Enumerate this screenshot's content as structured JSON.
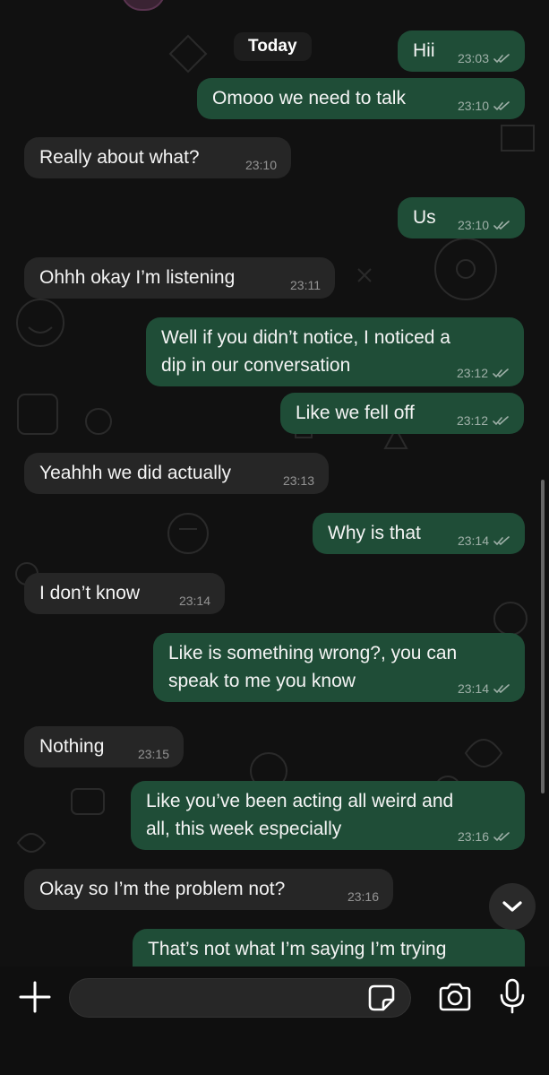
{
  "chat": {
    "date_chip": "Today",
    "messages": [
      {
        "dir": "out",
        "text": "Hii",
        "time": "23:03"
      },
      {
        "dir": "out",
        "text": "Omooo we need to talk",
        "time": "23:10"
      },
      {
        "dir": "in",
        "text": "Really about what?",
        "time": "23:10"
      },
      {
        "dir": "out",
        "text": "Us",
        "time": "23:10"
      },
      {
        "dir": "in",
        "text": "Ohhh okay I’m listening",
        "time": "23:11"
      },
      {
        "dir": "out",
        "text": "Well if you didn’t notice, I noticed a\ndip in our conversation",
        "time": "23:12"
      },
      {
        "dir": "out",
        "text": "Like we fell off",
        "time": "23:12"
      },
      {
        "dir": "in",
        "text": "Yeahhh we did actually",
        "time": "23:13"
      },
      {
        "dir": "out",
        "text": "Why is that",
        "time": "23:14"
      },
      {
        "dir": "in",
        "text": "I don’t know",
        "time": "23:14"
      },
      {
        "dir": "out",
        "text": "Like is something wrong?, you can\nspeak to me you know",
        "time": "23:14"
      },
      {
        "dir": "in",
        "text": "Nothing",
        "time": "23:15"
      },
      {
        "dir": "out",
        "text": "Like you’ve been acting all weird and\nall, this week especially",
        "time": "23:16"
      },
      {
        "dir": "in",
        "text": "Okay so I’m the problem not?",
        "time": "23:16"
      },
      {
        "dir": "out",
        "text": "That’s not what I’m saying I’m trying",
        "time": ""
      }
    ]
  },
  "composer": {
    "input_placeholder": "",
    "icons": {
      "add": "plus-icon",
      "sticker": "sticker-icon",
      "camera": "camera-icon",
      "mic": "microphone-icon",
      "scroll": "chevron-down-icon"
    }
  },
  "colors": {
    "outgoing_bubble": "#1f4d37",
    "incoming_bubble": "#262626",
    "background": "#111111"
  }
}
